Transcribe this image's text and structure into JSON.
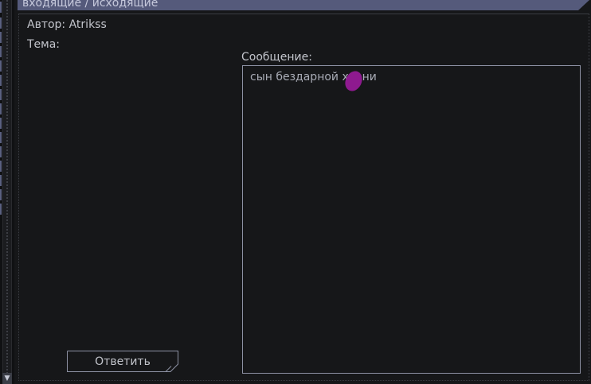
{
  "header": {
    "title": "входящие / исходящие"
  },
  "message": {
    "author_line": "Автор: Atrikss",
    "subject_line": "Тема:",
    "body_label": "Сообщение:",
    "body_text": "сын бездарной хуени"
  },
  "actions": {
    "reply_label": "Ответить"
  },
  "colors": {
    "header_bg": "#555a7b",
    "panel_bg": "#161719",
    "text": "#c3c5cc",
    "blot": "#8e1a8f"
  }
}
